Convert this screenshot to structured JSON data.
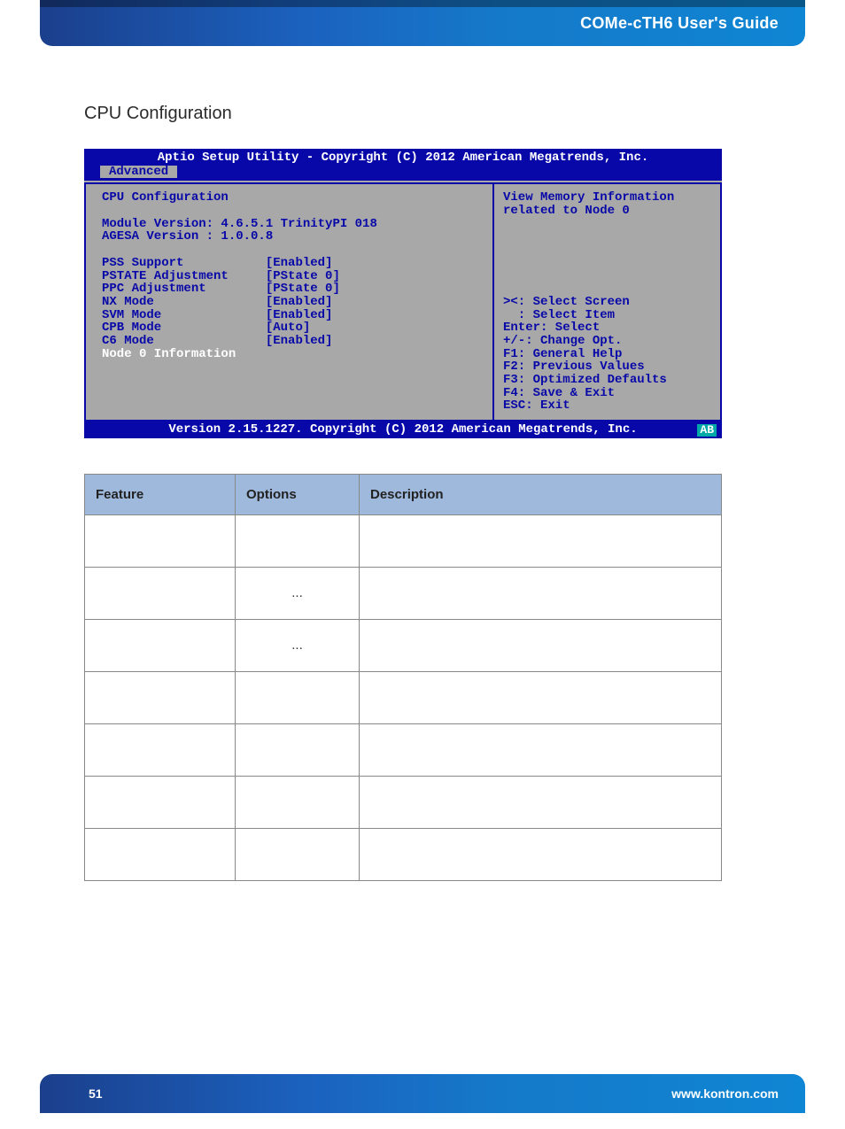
{
  "header": {
    "doc_title": "COMe-cTH6 User's Guide"
  },
  "section": {
    "title": "CPU Configuration"
  },
  "bios": {
    "titlebar": "Aptio Setup Utility - Copyright (C) 2012 American Megatrends, Inc.",
    "active_tab": "Advanced",
    "heading": "CPU Configuration",
    "module_line": "Module Version: 4.6.5.1 TrinityPI 018",
    "agesa_line": "AGESA Version : 1.0.0.8",
    "settings": [
      {
        "name": "PSS Support",
        "value": "[Enabled]"
      },
      {
        "name": "PSTATE Adjustment",
        "value": "[PState 0]"
      },
      {
        "name": "PPC Adjustment",
        "value": "[PState 0]"
      },
      {
        "name": "NX Mode",
        "value": "[Enabled]"
      },
      {
        "name": "SVM Mode",
        "value": "[Enabled]"
      },
      {
        "name": "CPB Mode",
        "value": "[Auto]"
      },
      {
        "name": "C6 Mode",
        "value": "[Enabled]"
      }
    ],
    "highlight_line": "Node 0 Information",
    "help_top_1": "View Memory Information",
    "help_top_2": "related to Node 0",
    "nav": {
      "l1": "><: Select Screen",
      "l2": "  : Select Item",
      "l3": "Enter: Select",
      "l4": "+/-: Change Opt.",
      "l5": "F1: General Help",
      "l6": "F2: Previous Values",
      "l7": "F3: Optimized Defaults",
      "l8": "F4: Save & Exit",
      "l9": "ESC: Exit"
    },
    "footer": "Version 2.15.1227. Copyright (C) 2012 American Megatrends, Inc.",
    "corner_badge": "AB"
  },
  "table": {
    "headers": {
      "col1": "Feature",
      "col2": "Options",
      "col3": "Description"
    },
    "rows": [
      {
        "feature": "",
        "options": "",
        "description": ""
      },
      {
        "feature": "",
        "options": "...",
        "description": ""
      },
      {
        "feature": "",
        "options": "...",
        "description": ""
      },
      {
        "feature": "",
        "options": "",
        "description": ""
      },
      {
        "feature": "",
        "options": "",
        "description": ""
      },
      {
        "feature": "",
        "options": "",
        "description": ""
      },
      {
        "feature": "",
        "options": "",
        "description": ""
      }
    ]
  },
  "footer": {
    "page_number": "51",
    "url": "www.kontron.com"
  }
}
